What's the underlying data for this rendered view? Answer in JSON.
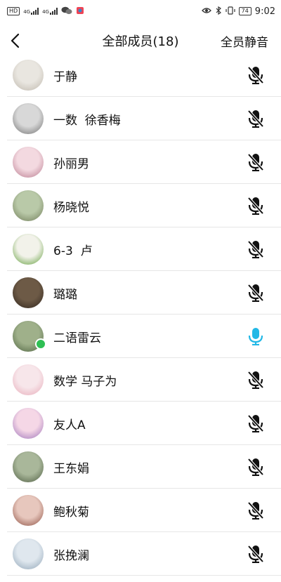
{
  "status_bar": {
    "left_chip": "HD",
    "net1": "4G",
    "net2": "4G",
    "battery": "74",
    "time": "9:02"
  },
  "header": {
    "title": "全部成员(18)",
    "mute_all_label": "全员静音"
  },
  "colors": {
    "mic_active": "#22b8e6",
    "mic_muted": "#111111",
    "divider": "#e6e6e6"
  },
  "members": [
    {
      "name": "于静",
      "mic": "muted"
    },
    {
      "name": "一数  徐香梅",
      "mic": "muted"
    },
    {
      "name": "孙丽男",
      "mic": "muted"
    },
    {
      "name": "杨晓悦",
      "mic": "muted"
    },
    {
      "name": "6-3  卢",
      "mic": "muted"
    },
    {
      "name": "璐璐",
      "mic": "muted"
    },
    {
      "name": "二语雷云",
      "mic": "active"
    },
    {
      "name": "数学 马子为",
      "mic": "muted"
    },
    {
      "name": "友人A",
      "mic": "muted"
    },
    {
      "name": "王东娟",
      "mic": "muted"
    },
    {
      "name": "鲍秋菊",
      "mic": "muted"
    },
    {
      "name": "张挽澜",
      "mic": "muted"
    }
  ]
}
